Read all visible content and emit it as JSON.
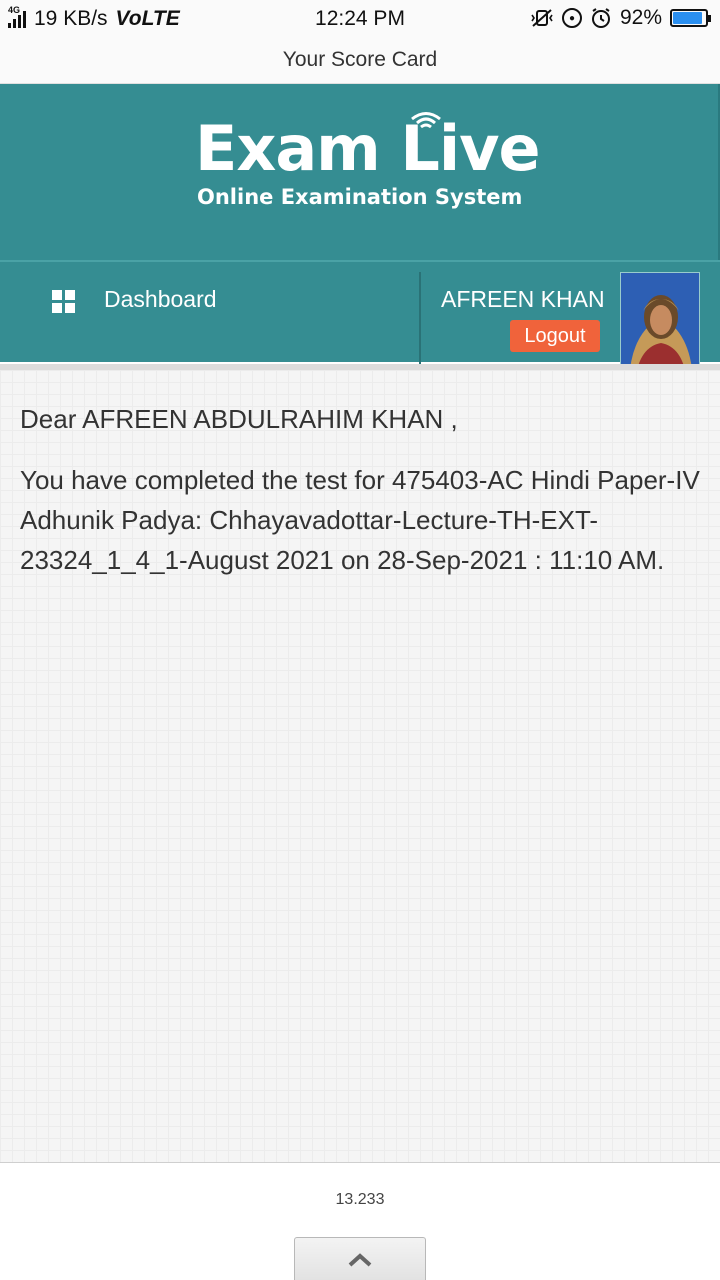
{
  "status_bar": {
    "network_tag": "4G",
    "speed": "19 KB/s",
    "volte": "VoLTE",
    "time": "12:24 PM",
    "battery": "92%",
    "battery_level": 0.92
  },
  "title_bar": {
    "title": "Your Score Card"
  },
  "header": {
    "logo_title": "Exam Live",
    "logo_subtitle": "Online Examination System"
  },
  "nav": {
    "dashboard_label": "Dashboard",
    "user_name": "AFREEN KHAN",
    "logout_label": "Logout"
  },
  "content": {
    "greeting": "Dear AFREEN ABDULRAHIM KHAN ,",
    "message": "You have completed the test for 475403-AC Hindi Paper-IV Adhunik Padya: Chhayavadottar-Lecture-TH-EXT-23324_1_4_1-August 2021 on 28-Sep-2021 : 11:10 AM."
  },
  "footer": {
    "version": "13.233"
  },
  "colors": {
    "header_bg": "#358d92",
    "logout_bg": "#f0633b",
    "battery_fill": "#2a8ff0"
  }
}
